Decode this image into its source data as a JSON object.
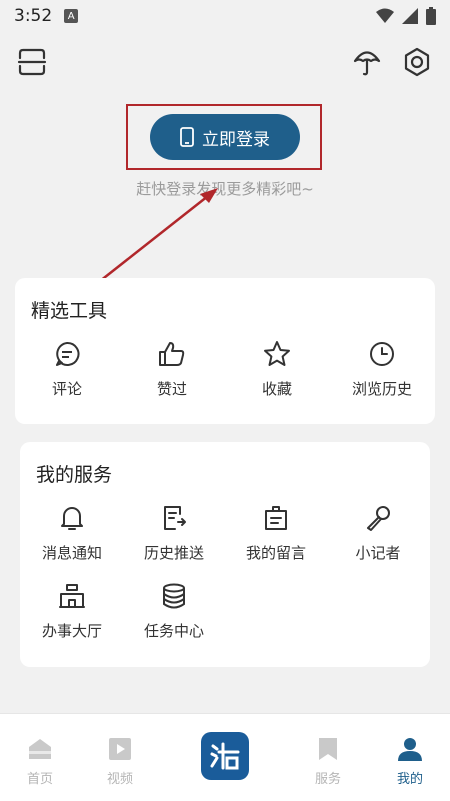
{
  "status_bar": {
    "time": "3:52",
    "notification_badge": "A"
  },
  "login": {
    "button_label": "立即登录",
    "subtitle": "赶快登录发现更多精彩吧~"
  },
  "tools": {
    "title": "精选工具",
    "items": [
      {
        "label": "评论",
        "icon": "comment-icon"
      },
      {
        "label": "赞过",
        "icon": "thumbs-up-icon"
      },
      {
        "label": "收藏",
        "icon": "star-icon"
      },
      {
        "label": "浏览历史",
        "icon": "clock-icon"
      }
    ]
  },
  "services": {
    "title": "我的服务",
    "items": [
      {
        "label": "消息通知",
        "icon": "bell-icon"
      },
      {
        "label": "历史推送",
        "icon": "push-history-icon"
      },
      {
        "label": "我的留言",
        "icon": "message-board-icon"
      },
      {
        "label": "小记者",
        "icon": "microphone-icon"
      },
      {
        "label": "办事大厅",
        "icon": "hall-icon"
      },
      {
        "label": "任务中心",
        "icon": "database-icon"
      }
    ]
  },
  "bottom_nav": {
    "items": [
      {
        "label": "首页",
        "active": false
      },
      {
        "label": "视频",
        "active": false
      },
      {
        "label": "服务",
        "active": false
      },
      {
        "label": "我的",
        "active": true
      }
    ],
    "center_logo": "app-logo"
  },
  "colors": {
    "accent": "#1f5f8b",
    "annotation": "#b1272b",
    "background": "#f1f1f1"
  }
}
